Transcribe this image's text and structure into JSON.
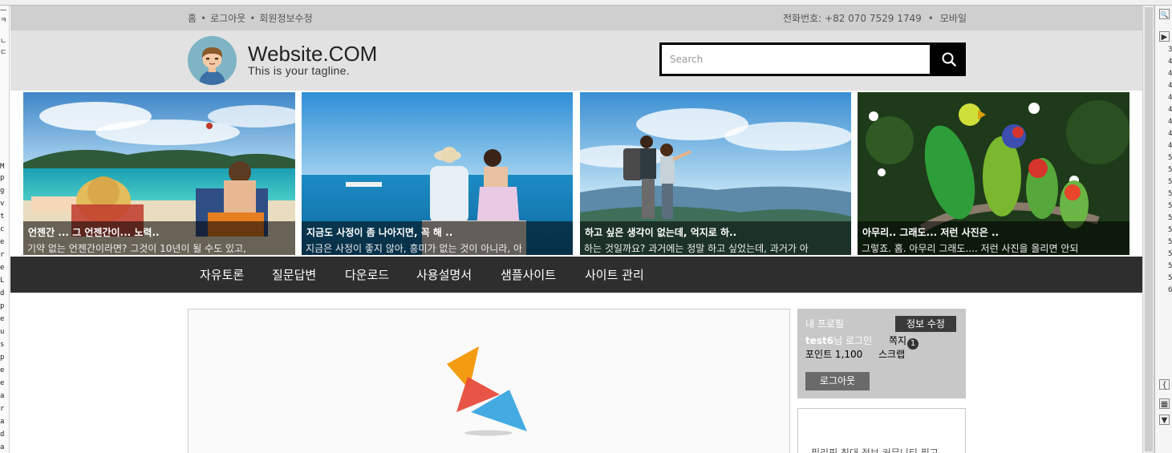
{
  "left_panel": {
    "chars": [
      "ㅡ",
      "ㅋ",
      "ㄴ",
      "ㄷ",
      "M",
      "p",
      "g",
      "v",
      "t",
      "c",
      "e",
      "r",
      "e",
      "L",
      "d",
      "p",
      "e",
      "u",
      "s",
      "p",
      "e",
      "e",
      "a",
      "r",
      "a",
      "d",
      "a",
      "a",
      "a",
      "a",
      "a",
      "a"
    ]
  },
  "right_panel": {
    "numbers": [
      "3",
      "4",
      "4",
      "4",
      "4",
      "4",
      "4",
      "4",
      "4",
      "5",
      "5",
      "5",
      "5",
      "5",
      "5",
      "5",
      "5",
      "5",
      "5",
      "5",
      "6"
    ],
    "icons": [
      "magnifier-icon",
      "expand-icon",
      "brace-icon",
      "grid-icon",
      "arrow-down-icon"
    ]
  },
  "topbar": {
    "links": [
      "홈",
      "로그아웃",
      "회원정보수정"
    ],
    "phone_label": "전화번호: +82 070 7529 1749",
    "mobile_label": "모바일",
    "bullet": "•"
  },
  "header": {
    "site_name": "Website.COM",
    "tagline": "This is your tagline.",
    "search_placeholder": "Search",
    "search_icon": "search-icon"
  },
  "slides": [
    {
      "title": "언젠간 ... 그 언젠간이... 노력..",
      "text": "기약 없는 언젠간이라면? 그것이 10년이 될 수도 있고,"
    },
    {
      "title": "지금도 사정이 좀 나아지면, 꼭 해 ..",
      "text": "지금은 사정이 좋지 않아, 흥미가 없는 것이 아니라, 아"
    },
    {
      "title": "하고 싶은 생각이 없는데, 억지로 하..",
      "text": "하는 것일까요? 과거에는 정말 하고 싶었는데, 과거가 아"
    },
    {
      "title": "아무리.. 그래도... 저런 사진은 ..",
      "text": "그렇죠. 홈. 아무리 그래도.... 저런 사진을 올리면 안되"
    }
  ],
  "nav": {
    "items": [
      "자유토론",
      "질문답변",
      "다운로드",
      "사용설명서",
      "샘플사이트",
      "사이트 관리"
    ]
  },
  "profile": {
    "title": "내 프로필",
    "edit_label": "정보 수정",
    "username": "test6",
    "login_suffix": "님 로그인",
    "message_label": "쪽지",
    "message_count": "1",
    "point_label": "포인트 1,100",
    "scrap_label": "스크랩",
    "logout_label": "로그아웃"
  },
  "side_box": {
    "text": "필리핀 최대 정보 커뮤니티 필고"
  },
  "colors": {
    "topbar": "#cfcfcf",
    "header": "#e2e2e2",
    "navbar": "#2e2e2e",
    "profile_bg": "#c8c8c8",
    "logo_orange": "#f39c12",
    "logo_red": "#e74c3c",
    "logo_blue": "#3aa6e0"
  }
}
